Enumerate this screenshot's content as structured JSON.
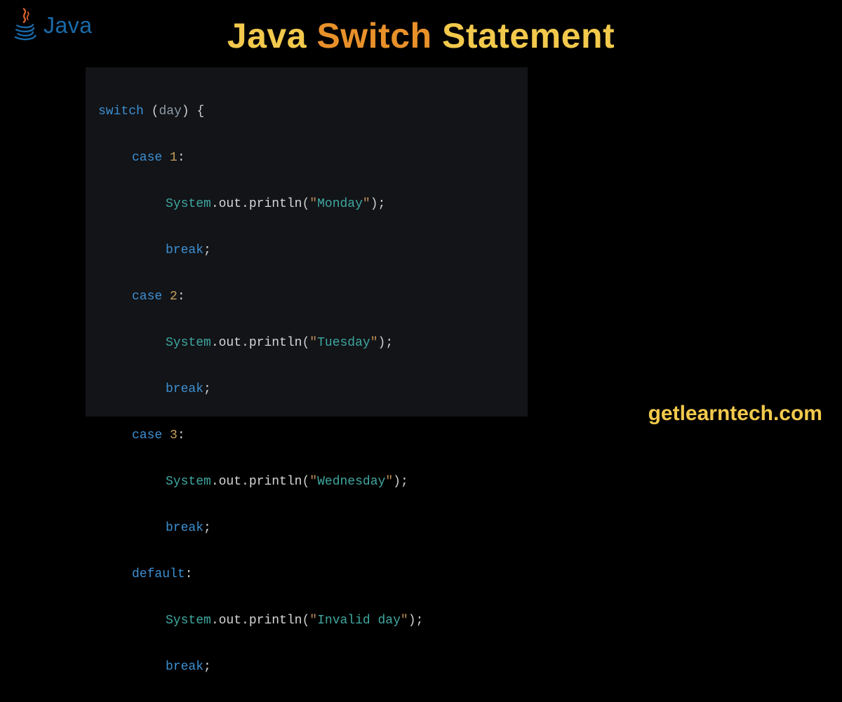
{
  "logo": {
    "text": "Java"
  },
  "title": {
    "word1": "Java",
    "word2": "Switch",
    "word3": "Statement"
  },
  "code": {
    "kw_switch": "switch",
    "kw_case": "case",
    "kw_break": "break",
    "kw_default": "default",
    "var": "day",
    "num1": "1",
    "num2": "2",
    "num3": "3",
    "sys": "System",
    "out": "out",
    "println": "println",
    "str1": "Monday",
    "str2": "Tuesday",
    "str3": "Wednesday",
    "str4": "Invalid day",
    "open_paren": "(",
    "close_paren": ")",
    "open_brace": "{",
    "colon": ":",
    "semi": ";",
    "dot": ".",
    "quote": "\""
  },
  "site": "getlearntech.com"
}
